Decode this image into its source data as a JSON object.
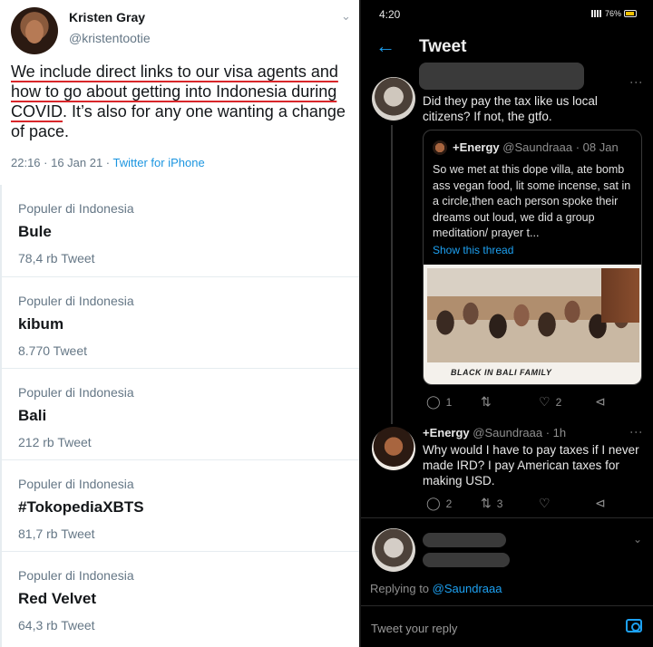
{
  "left": {
    "author": {
      "name": "Kristen Gray",
      "handle": "@kristentootie"
    },
    "tweet": {
      "text_highlighted": "We include direct links to our visa agents and how to go about getting into Indonesia during COVID",
      "text_rest": ". It’s also for any one wanting a change of pace.",
      "timestamp": "22:16 · 16 Jan 21 · ",
      "source": "Twitter for iPhone"
    },
    "trends": [
      {
        "context": "Populer di Indonesia",
        "name": "Bule",
        "count": "78,4 rb Tweet"
      },
      {
        "context": "Populer di Indonesia",
        "name": "kibum",
        "count": "8.770 Tweet"
      },
      {
        "context": "Populer di Indonesia",
        "name": "Bali",
        "count": "212 rb Tweet"
      },
      {
        "context": "Populer di Indonesia",
        "name": "#TokopediaXBTS",
        "count": "81,7 rb Tweet"
      },
      {
        "context": "Populer di Indonesia",
        "name": "Red Velvet",
        "count": "64,3 rb Tweet"
      }
    ]
  },
  "right": {
    "status_bar": {
      "time": "4:20",
      "battery": "76%"
    },
    "header": {
      "title": "Tweet"
    },
    "tweet1": {
      "text": "Did they pay the tax like us local citizens? If not, the gtfo.",
      "quoted": {
        "author": "+Energy",
        "handle_time": " @Saundraaa · 08 Jan",
        "text": "So we met at this dope villa, ate bomb ass vegan food, lit some incense, sat in a circle,then each person spoke their dreams out loud, we did a group meditation/ prayer t...",
        "show_thread": "Show this thread",
        "photo_caption": "BLACK IN BALI FAMILY"
      },
      "replies": "1",
      "likes": "2"
    },
    "tweet2": {
      "author": "+Energy",
      "handle_time": " @Saundraaa · 1h",
      "text": "Why would I have to pay taxes if I never made IRD? I pay American taxes for making USD.",
      "replies": "2",
      "retweets": "3"
    },
    "reply_context": {
      "prefix": "Replying to ",
      "handle": "@Saundraaa"
    },
    "compose": {
      "placeholder": "Tweet your reply"
    },
    "icons": [
      "back-arrow-icon",
      "more-icon",
      "reply-icon",
      "retweet-icon",
      "like-icon",
      "share-icon",
      "chevron-down-icon",
      "camera-icon"
    ],
    "accent": "#1da1f2"
  }
}
